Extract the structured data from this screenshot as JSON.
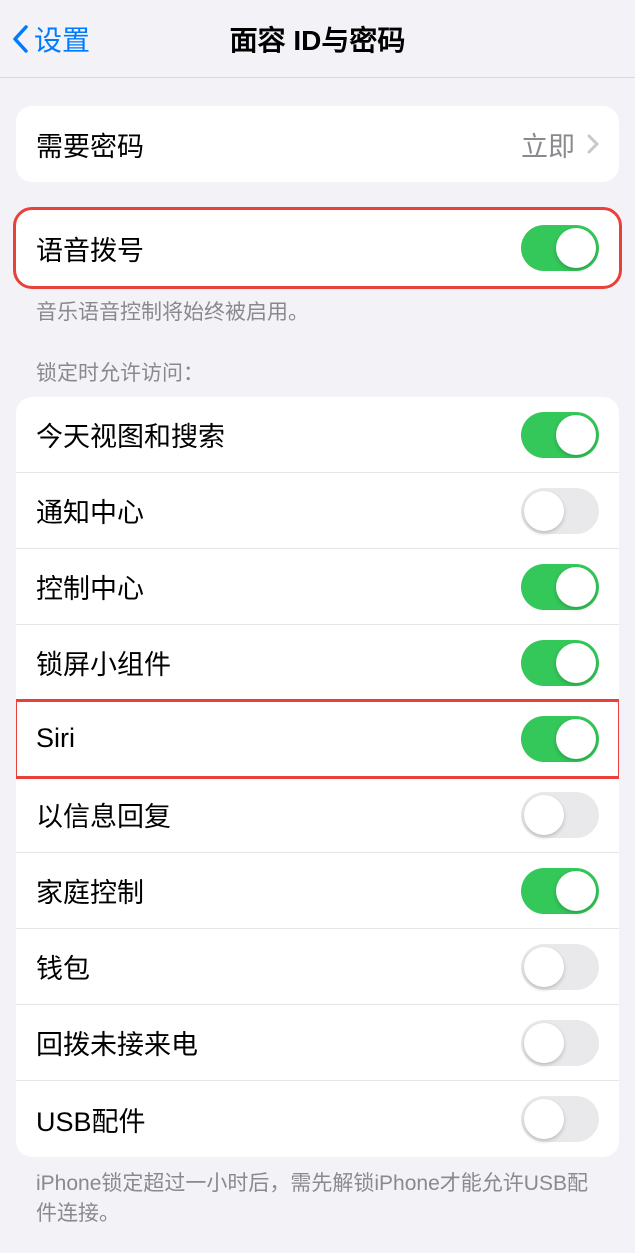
{
  "header": {
    "back_label": "设置",
    "title": "面容 ID与密码"
  },
  "passcode_row": {
    "label": "需要密码",
    "value": "立即"
  },
  "voice_dial": {
    "label": "语音拨号",
    "footer": "音乐语音控制将始终被启用。",
    "on": true
  },
  "lock_section_header": "锁定时允许访问：",
  "lock_items": [
    {
      "label": "今天视图和搜索",
      "on": true
    },
    {
      "label": "通知中心",
      "on": false
    },
    {
      "label": "控制中心",
      "on": true
    },
    {
      "label": "锁屏小组件",
      "on": true
    },
    {
      "label": "Siri",
      "on": true
    },
    {
      "label": "以信息回复",
      "on": false
    },
    {
      "label": "家庭控制",
      "on": true
    },
    {
      "label": "钱包",
      "on": false
    },
    {
      "label": "回拨未接来电",
      "on": false
    },
    {
      "label": "USB配件",
      "on": false
    }
  ],
  "lock_footer": "iPhone锁定超过一小时后，需先解锁iPhone才能允许USB配件连接。",
  "highlighted_lock_items": [
    4
  ],
  "colors": {
    "accent": "#007aff",
    "toggle_on": "#34c759",
    "highlight": "#ea3f3a"
  }
}
